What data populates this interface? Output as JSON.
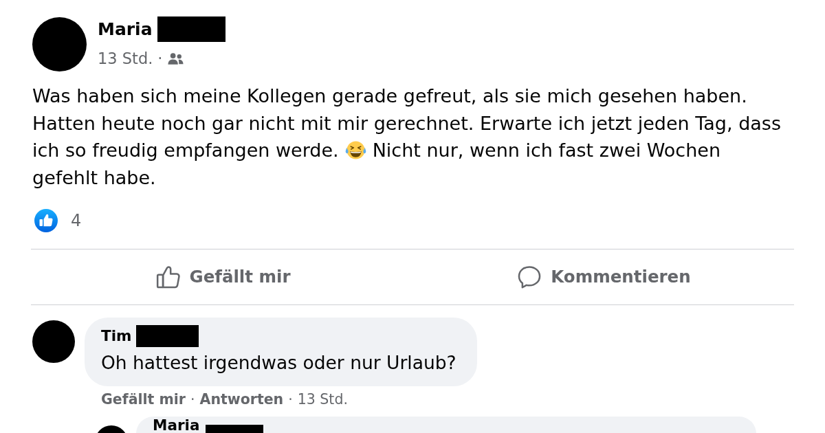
{
  "post": {
    "author": {
      "name": "Maria",
      "redacted": true
    },
    "time": "13 Std.",
    "separator": "·",
    "body": [
      {
        "kind": "text",
        "text": "Was haben sich meine Kollegen gerade gefreut, als sie mich gesehen haben.\nHatten heute noch gar nicht mit mir gerechnet. Erwarte ich jetzt jeden Tag, dass ich so freudig empfangen werde."
      },
      {
        "kind": "emoji"
      },
      {
        "kind": "text",
        "text": "Nicht nur, wenn ich fast zwei Wochen gefehlt habe."
      }
    ],
    "reactions": {
      "count": "4"
    },
    "actions": [
      {
        "kind": "like",
        "label": "Gefällt mir"
      },
      {
        "kind": "comment",
        "label": "Kommentieren"
      }
    ]
  },
  "comments": [
    {
      "author": {
        "name": "Tim",
        "redacted": true
      },
      "text": "Oh hattest irgendwas oder nur Urlaub?",
      "footer": [
        {
          "kind": "like",
          "text": "Gefällt mir"
        },
        {
          "kind": "dot",
          "text": "·"
        },
        {
          "kind": "reply",
          "text": "Antworten"
        },
        {
          "kind": "dot",
          "text": "·"
        },
        {
          "kind": "time",
          "text": "13 Std."
        }
      ],
      "replies": [
        {
          "author": {
            "name": "Maria",
            "redacted": true
          }
        }
      ]
    }
  ]
}
